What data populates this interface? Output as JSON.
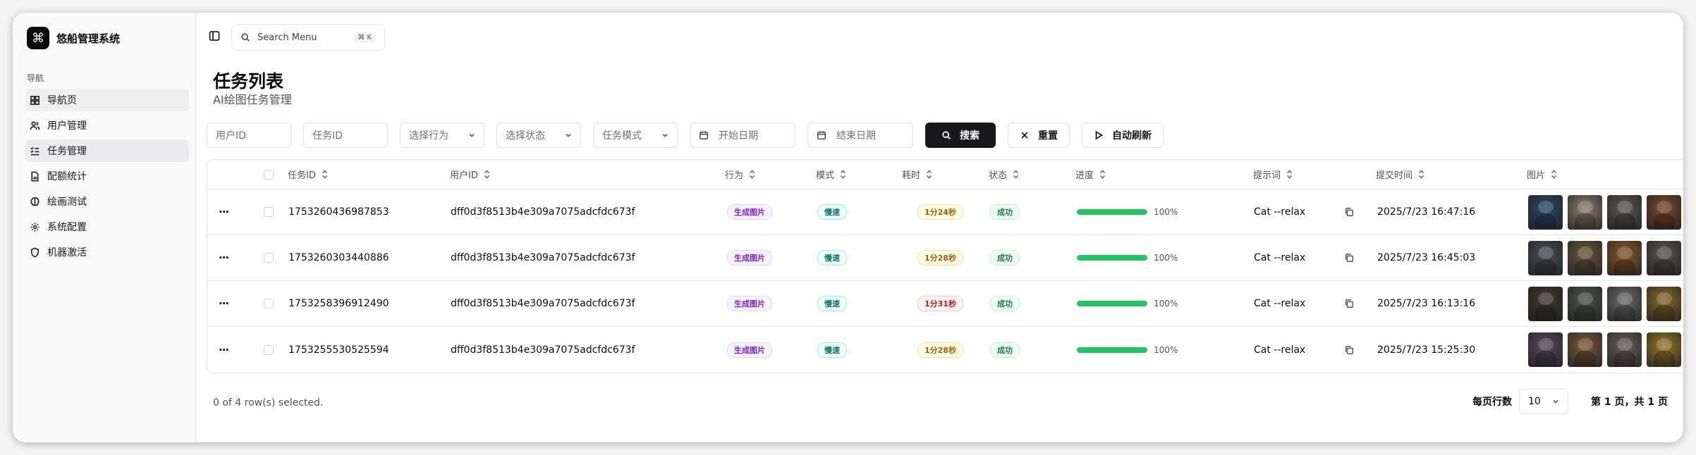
{
  "brand": {
    "name": "悠船管理系统",
    "logo_glyph": "⌘"
  },
  "nav": {
    "group_label": "导航",
    "items": [
      {
        "label": "导航页",
        "icon": "grid-icon"
      },
      {
        "label": "用户管理",
        "icon": "users-icon"
      },
      {
        "label": "任务管理",
        "icon": "list-checks-icon"
      },
      {
        "label": "配额统计",
        "icon": "file-chart-icon"
      },
      {
        "label": "绘画测试",
        "icon": "brain-icon"
      },
      {
        "label": "系统配置",
        "icon": "gear-icon"
      },
      {
        "label": "机器激活",
        "icon": "shield-icon"
      }
    ]
  },
  "topbar": {
    "search_placeholder": "Search Menu",
    "search_shortcut": "⌘ K"
  },
  "page": {
    "title": "任务列表",
    "subtitle": "AI绘图任务管理"
  },
  "filters": {
    "user_id_placeholder": "用户ID",
    "task_id_placeholder": "任务ID",
    "action_select": "选择行为",
    "status_select": "选择状态",
    "mode_select": "任务模式",
    "start_date": "开始日期",
    "end_date": "结束日期",
    "search_btn": "搜索",
    "reset_btn": "重置",
    "autorefresh_btn": "自动刷新"
  },
  "table": {
    "headers": {
      "task_id": "任务ID",
      "user_id": "用户ID",
      "action": "行为",
      "mode": "模式",
      "duration": "耗时",
      "status": "状态",
      "progress": "进度",
      "prompt": "提示词",
      "submit_time": "提交时间",
      "images": "图片"
    },
    "rows": [
      {
        "task_id": "1753260436987853",
        "user_id": "dff0d3f8513b4e309a7075adcfdc673f",
        "action": "生成图片",
        "mode": "慢速",
        "duration": "1分24秒",
        "duration_tone": "amber",
        "status": "成功",
        "progress": 100,
        "progress_label": "100%",
        "prompt": "Cat --relax",
        "submit_time": "2025/7/23 16:47:16",
        "image_colors": [
          "#2d4a6b",
          "#8a7f6e",
          "#5c5a55",
          "#7a4a2e"
        ]
      },
      {
        "task_id": "1753260303440886",
        "user_id": "dff0d3f8513b4e309a7075adcfdc673f",
        "action": "生成图片",
        "mode": "慢速",
        "duration": "1分28秒",
        "duration_tone": "amber",
        "status": "成功",
        "progress": 100,
        "progress_label": "100%",
        "prompt": "Cat --relax",
        "submit_time": "2025/7/23 16:45:03",
        "image_colors": [
          "#4a4f55",
          "#6b5a3e",
          "#8a5a2e",
          "#5a5550"
        ]
      },
      {
        "task_id": "1753258396912490",
        "user_id": "dff0d3f8513b4e309a7075adcfdc673f",
        "action": "生成图片",
        "mode": "慢速",
        "duration": "1分31秒",
        "duration_tone": "red",
        "status": "成功",
        "progress": 100,
        "progress_label": "100%",
        "prompt": "Cat --relax",
        "submit_time": "2025/7/23 16:13:16",
        "image_colors": [
          "#3e3a30",
          "#4a5a48",
          "#6e6e6e",
          "#8a6a2e"
        ]
      },
      {
        "task_id": "1753255530525594",
        "user_id": "dff0d3f8513b4e309a7075adcfdc673f",
        "action": "生成图片",
        "mode": "慢速",
        "duration": "1分28秒",
        "duration_tone": "amber",
        "status": "成功",
        "progress": 100,
        "progress_label": "100%",
        "prompt": "Cat --relax",
        "submit_time": "2025/7/23 15:25:30",
        "image_colors": [
          "#5a4a5e",
          "#7a5a3a",
          "#6a6258",
          "#9a7a2a"
        ]
      }
    ]
  },
  "footer": {
    "selection": "0 of 4 row(s) selected.",
    "rows_per_page_label": "每页行数",
    "rows_per_page": "10",
    "page_info": "第 1 页，共 1 页"
  }
}
